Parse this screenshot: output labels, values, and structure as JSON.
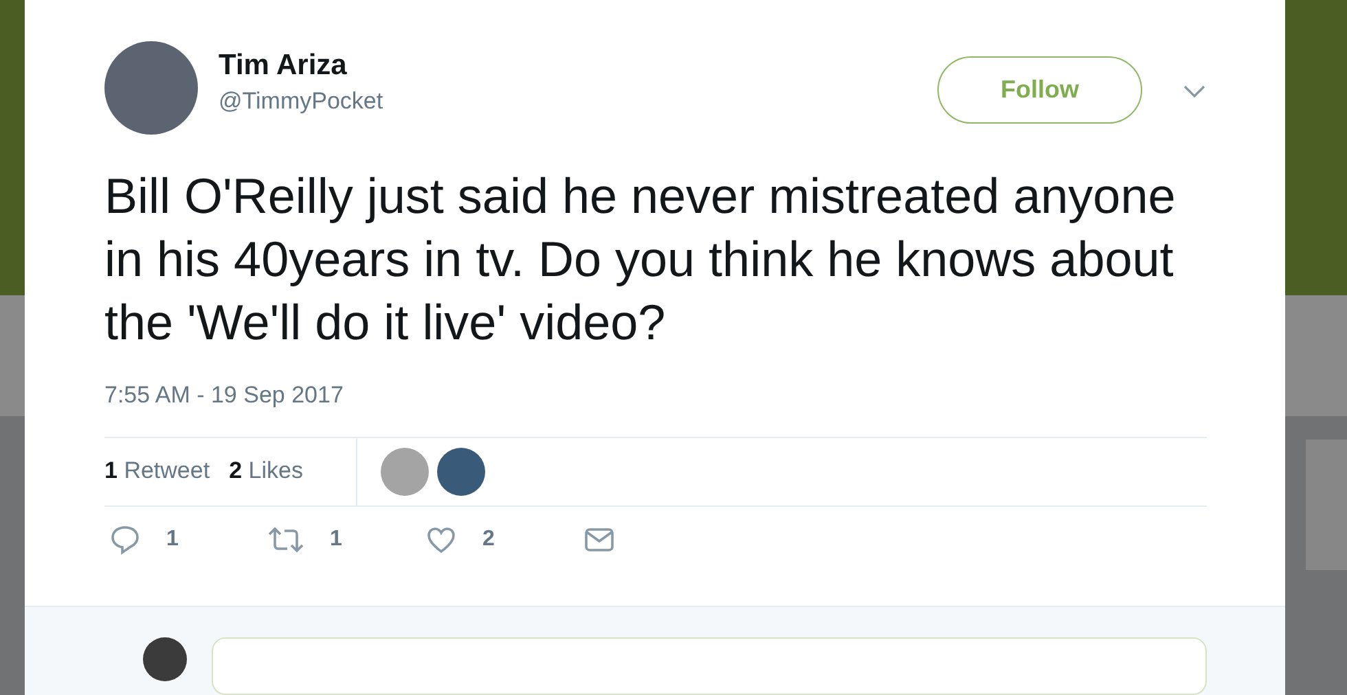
{
  "tweet": {
    "author": {
      "name": "Tim Ariza",
      "handle": "@TimmyPocket"
    },
    "follow_button": "Follow",
    "text": "Bill O'Reilly just said he never mistreated anyone in his 40years in tv. Do you think he knows about the 'We'll do it live' video?",
    "timestamp": "7:55 AM - 19 Sep 2017",
    "stats": [
      {
        "count": "1",
        "label": "Retweet"
      },
      {
        "count": "2",
        "label": "Likes"
      }
    ],
    "actions": [
      {
        "kind": "reply",
        "count": "1"
      },
      {
        "kind": "retweet",
        "count": "1"
      },
      {
        "kind": "like",
        "count": "2"
      },
      {
        "kind": "message"
      }
    ]
  }
}
